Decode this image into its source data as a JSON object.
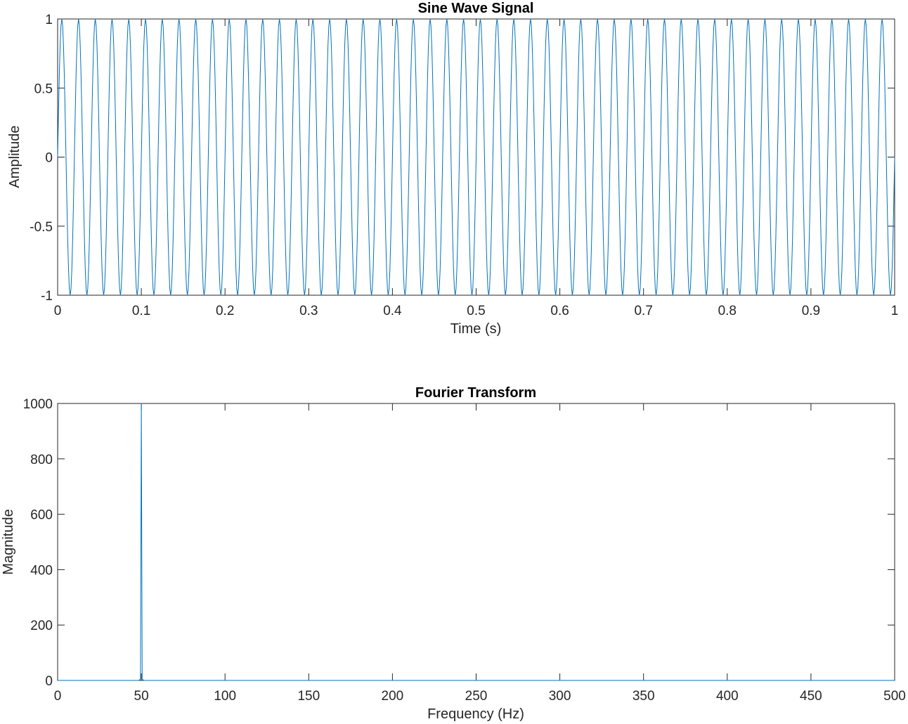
{
  "chart_data": [
    {
      "type": "line",
      "title": "Sine Wave Signal",
      "xlabel": "Time (s)",
      "ylabel": "Amplitude",
      "xlim": [
        0,
        1
      ],
      "ylim": [
        -1,
        1
      ],
      "xticks": [
        0,
        0.1,
        0.2,
        0.3,
        0.4,
        0.5,
        0.6,
        0.7,
        0.8,
        0.9,
        1
      ],
      "xtick_labels": [
        "0",
        "0.1",
        "0.2",
        "0.3",
        "0.4",
        "0.5",
        "0.6",
        "0.7",
        "0.8",
        "0.9",
        "1"
      ],
      "yticks": [
        -1,
        -0.5,
        0,
        0.5,
        1
      ],
      "ytick_labels": [
        "-1",
        "-0.5",
        "0",
        "0.5",
        "1"
      ],
      "grid": false,
      "line_color": "#0072bd",
      "series": [
        {
          "function": "sin",
          "amplitude": 1,
          "frequency_hz": 50,
          "x_start": 0,
          "x_end": 1,
          "sample_rate": 1000
        }
      ]
    },
    {
      "type": "line",
      "title": "Fourier Transform",
      "xlabel": "Frequency (Hz)",
      "ylabel": "Magnitude",
      "xlim": [
        0,
        500
      ],
      "ylim": [
        0,
        1000
      ],
      "xticks": [
        0,
        50,
        100,
        150,
        200,
        250,
        300,
        350,
        400,
        450,
        500
      ],
      "xtick_labels": [
        "0",
        "50",
        "100",
        "150",
        "200",
        "250",
        "300",
        "350",
        "400",
        "450",
        "500"
      ],
      "yticks": [
        0,
        200,
        400,
        600,
        800,
        1000
      ],
      "ytick_labels": [
        "0",
        "200",
        "400",
        "600",
        "800",
        "1000"
      ],
      "grid": false,
      "line_color": "#0072bd",
      "series": [
        {
          "x": [
            0,
            48.5,
            49.5,
            50,
            50.5,
            51.5,
            500
          ],
          "y": [
            0,
            0,
            5,
            1000,
            5,
            0,
            0
          ]
        }
      ]
    }
  ]
}
